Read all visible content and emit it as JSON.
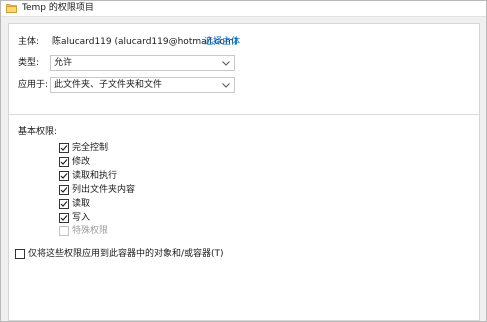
{
  "window": {
    "title": "Temp 的权限项目"
  },
  "principal": {
    "label": "主体:",
    "value": "陈alucard119 (alucard119@hotmail.com)",
    "select_link": "选择主体"
  },
  "type": {
    "label": "类型:",
    "value": "允许"
  },
  "applies_to": {
    "label": "应用于:",
    "value": "此文件夹、子文件夹和文件"
  },
  "basic_permissions": {
    "heading": "基本权限:",
    "items": [
      {
        "label": "完全控制",
        "checked": true,
        "enabled": true
      },
      {
        "label": "修改",
        "checked": true,
        "enabled": true
      },
      {
        "label": "读取和执行",
        "checked": true,
        "enabled": true
      },
      {
        "label": "列出文件夹内容",
        "checked": true,
        "enabled": true
      },
      {
        "label": "读取",
        "checked": true,
        "enabled": true
      },
      {
        "label": "写入",
        "checked": true,
        "enabled": true
      },
      {
        "label": "特殊权限",
        "checked": false,
        "enabled": false
      }
    ]
  },
  "apply_to_children": {
    "label": "仅将这些权限应用到此容器中的对象和/或容器(T)",
    "checked": false
  },
  "icons": {
    "folder": "folder-icon",
    "dropdown": "chevron-down-icon",
    "check": "checkmark-icon"
  },
  "colors": {
    "link": "#0066cc",
    "folder": "#e8b84a",
    "disabled_text": "#9c9c9c"
  }
}
